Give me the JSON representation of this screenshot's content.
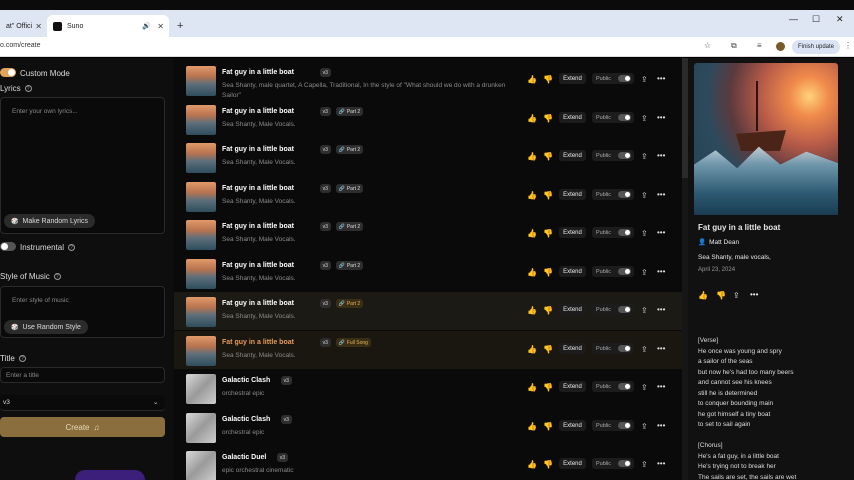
{
  "browser": {
    "tab1_label": "at\" Offici",
    "tab2_label": "Suno",
    "url": "o.com/create",
    "finish_update": "Finish update"
  },
  "left": {
    "custom_mode": "Custom Mode",
    "lyrics_label": "Lyrics",
    "lyrics_placeholder": "Enter your own lyrics...",
    "random_lyrics": "Make Random Lyrics",
    "instrumental": "Instrumental",
    "style_label": "Style of Music",
    "style_placeholder": "Enter style of music",
    "random_style": "Use Random Style",
    "title_label": "Title",
    "title_placeholder": "Enter a title",
    "model": "v3",
    "create": "Create"
  },
  "songs": [
    {
      "title": "Fat guy in a little boat",
      "version": "v3",
      "tag": "",
      "desc": "Sea Shanty, male quartet, A Capella, Traditional, In the style of \"What should we do with a drunken Sailor\""
    },
    {
      "title": "Fat guy in a little boat",
      "version": "v3",
      "tag": "Part 2",
      "desc": "Sea Shanty, Male Vocals."
    },
    {
      "title": "Fat guy in a little boat",
      "version": "v3",
      "tag": "Part 2",
      "desc": "Sea Shanty, Male Vocals."
    },
    {
      "title": "Fat guy in a little boat",
      "version": "v3",
      "tag": "Part 2",
      "desc": "Sea Shanty, Male Vocals."
    },
    {
      "title": "Fat guy in a little boat",
      "version": "v3",
      "tag": "Part 2",
      "desc": "Sea Shanty, Male Vocals."
    },
    {
      "title": "Fat guy in a little boat",
      "version": "v3",
      "tag": "Part 2",
      "desc": "Sea Shanty, Male Vocals."
    },
    {
      "title": "Fat guy in a little boat",
      "version": "v3",
      "tag": "Part 2",
      "desc": "Sea Shanty, Male Vocals."
    },
    {
      "title": "Fat guy in a little boat",
      "version": "v3",
      "tag": "Full Song",
      "desc": "Sea Shanty, Male Vocals."
    },
    {
      "title": "Galactic Clash",
      "version": "v3",
      "tag": "",
      "desc": "orchestral epic"
    },
    {
      "title": "Galactic Clash",
      "version": "v3",
      "tag": "",
      "desc": "orchestral epic"
    },
    {
      "title": "Galactic Duel",
      "version": "v3",
      "tag": "",
      "desc": "epic orchestral cinematic"
    }
  ],
  "row_labels": {
    "extend": "Extend",
    "public": "Public"
  },
  "detail": {
    "title": "Fat guy in a little boat",
    "artist": "Matt Dean",
    "style": "Sea Shanty, male vocals,",
    "date": "April 23, 2024",
    "lyrics": [
      "[Verse]",
      "He once was young and spry",
      "a sailor of the seas",
      "but now he's had too many beers",
      "and cannot see his knees",
      "still he is determined",
      "to conquer bounding main",
      "he got himself a tiny boat",
      "to set to sail again",
      "",
      "[Chorus]",
      "He's a fat guy, in a little boat",
      "He's trying not to break her",
      "The sails are set, the sails are wet"
    ]
  }
}
